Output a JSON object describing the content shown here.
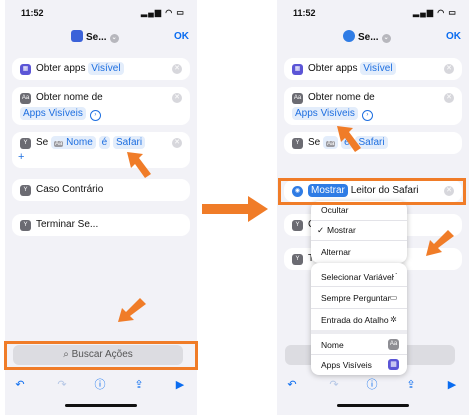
{
  "status": {
    "time": "11:52",
    "battery": "66"
  },
  "nav": {
    "title_left": "Se...",
    "title_right": "Se...",
    "done": "OK"
  },
  "actions": {
    "get_apps": {
      "label": "Obter apps",
      "token": "Visível",
      "token_right": "Visível"
    },
    "get_name": {
      "label": "Obter nome de",
      "token": "Apps Visíveis"
    },
    "if_block": {
      "label": "Se",
      "var": "Nome",
      "op": "é",
      "value": "Safari"
    },
    "otherwise": {
      "label": "Caso Contrário",
      "label_short": "C"
    },
    "end_if": {
      "label": "Terminar Se...",
      "label_short": "T"
    }
  },
  "search": {
    "placeholder": "Buscar Ações"
  },
  "action_row": {
    "token": "Mostrar",
    "label": "Leitor do Safari"
  },
  "menu": {
    "items": [
      "Ocultar",
      "Mostrar",
      "Alternar"
    ],
    "selected": "Mostrar",
    "variables": [
      "Selecionar Variável",
      "Sempre Perguntar",
      "Entrada do Atalho"
    ],
    "bottom": [
      "Nome",
      "Apps Visíveis"
    ]
  },
  "annotation_color": "#f07c28"
}
